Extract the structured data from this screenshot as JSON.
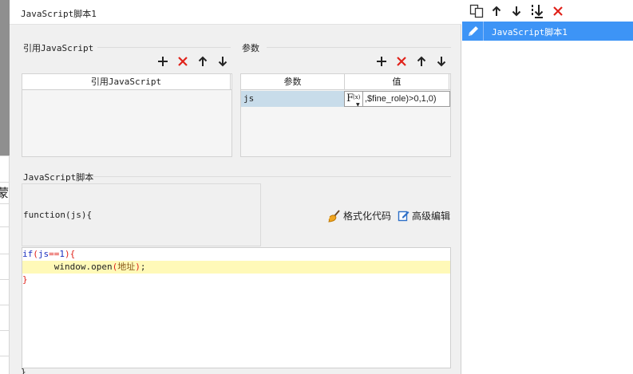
{
  "dialog": {
    "title": "JavaScript脚本1",
    "refs": {
      "section_title": "引用JavaScript",
      "column_header": "引用JavaScript"
    },
    "params": {
      "section_title": "参数",
      "columns": [
        "参数",
        "值"
      ],
      "rows": [
        {
          "name": "js",
          "fx": "F",
          "fx_sub": "(x)",
          "value": ",$fine_role)>0,1,0)"
        }
      ]
    },
    "script": {
      "section_title": "JavaScript脚本",
      "function_header": "function(js){",
      "format_label": "格式化代码",
      "advanced_label": "高级编辑",
      "code_lines": [
        {
          "parts": [
            {
              "t": "if",
              "c": "kw"
            },
            {
              "t": "(",
              "c": "br"
            },
            {
              "t": "js",
              "c": "kw"
            },
            {
              "t": "==",
              "c": "op"
            },
            {
              "t": "1",
              "c": "kw"
            },
            {
              "t": ")",
              "c": "br"
            },
            {
              "t": "{",
              "c": "br"
            }
          ]
        },
        {
          "parts": [
            {
              "t": "      window.open",
              "c": ""
            },
            {
              "t": "(",
              "c": "br"
            },
            {
              "t": "地址",
              "c": "str"
            },
            {
              "t": ")",
              "c": "br"
            },
            {
              "t": ";",
              "c": ""
            }
          ],
          "highlight": true
        },
        {
          "parts": [
            {
              "t": "}",
              "c": "br"
            }
          ]
        }
      ],
      "closing": "}"
    }
  },
  "left_bg": {
    "char": "蒙"
  },
  "right_panel": {
    "items": [
      {
        "label": "JavaScript脚本1",
        "selected": true
      }
    ]
  },
  "colors": {
    "accent": "#3d94f6",
    "delete": "#e0221a",
    "highlight": "#fff9b8",
    "selected_cell": "#c8dcea"
  }
}
